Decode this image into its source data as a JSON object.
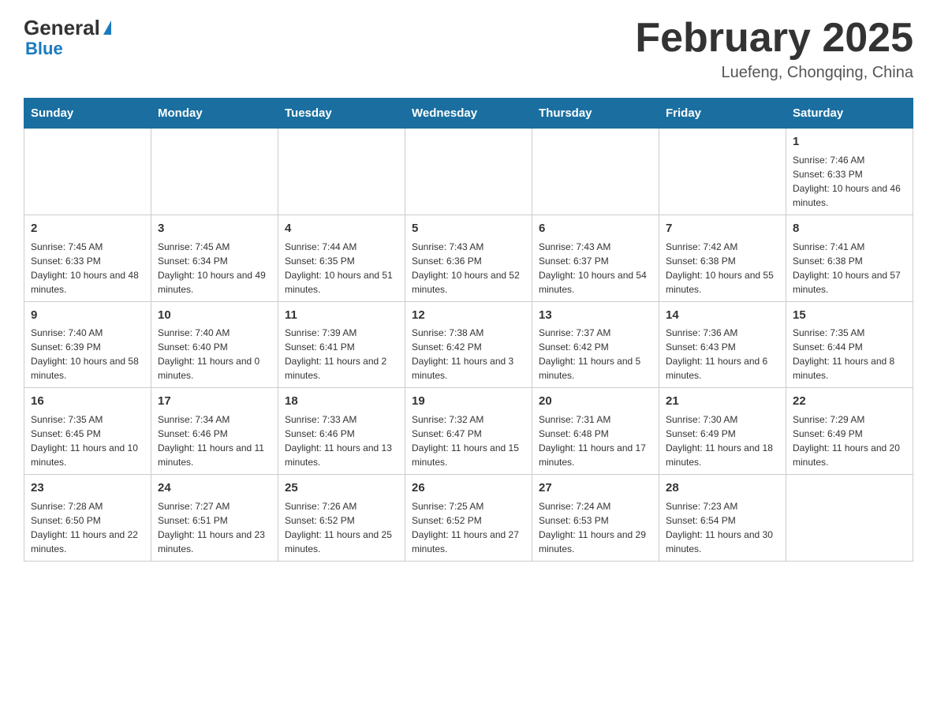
{
  "header": {
    "logo_general": "General",
    "logo_blue": "Blue",
    "title": "February 2025",
    "subtitle": "Luefeng, Chongqing, China"
  },
  "days_of_week": [
    "Sunday",
    "Monday",
    "Tuesday",
    "Wednesday",
    "Thursday",
    "Friday",
    "Saturday"
  ],
  "weeks": [
    {
      "days": [
        {
          "num": "",
          "info": ""
        },
        {
          "num": "",
          "info": ""
        },
        {
          "num": "",
          "info": ""
        },
        {
          "num": "",
          "info": ""
        },
        {
          "num": "",
          "info": ""
        },
        {
          "num": "",
          "info": ""
        },
        {
          "num": "1",
          "info": "Sunrise: 7:46 AM\nSunset: 6:33 PM\nDaylight: 10 hours and 46 minutes."
        }
      ]
    },
    {
      "days": [
        {
          "num": "2",
          "info": "Sunrise: 7:45 AM\nSunset: 6:33 PM\nDaylight: 10 hours and 48 minutes."
        },
        {
          "num": "3",
          "info": "Sunrise: 7:45 AM\nSunset: 6:34 PM\nDaylight: 10 hours and 49 minutes."
        },
        {
          "num": "4",
          "info": "Sunrise: 7:44 AM\nSunset: 6:35 PM\nDaylight: 10 hours and 51 minutes."
        },
        {
          "num": "5",
          "info": "Sunrise: 7:43 AM\nSunset: 6:36 PM\nDaylight: 10 hours and 52 minutes."
        },
        {
          "num": "6",
          "info": "Sunrise: 7:43 AM\nSunset: 6:37 PM\nDaylight: 10 hours and 54 minutes."
        },
        {
          "num": "7",
          "info": "Sunrise: 7:42 AM\nSunset: 6:38 PM\nDaylight: 10 hours and 55 minutes."
        },
        {
          "num": "8",
          "info": "Sunrise: 7:41 AM\nSunset: 6:38 PM\nDaylight: 10 hours and 57 minutes."
        }
      ]
    },
    {
      "days": [
        {
          "num": "9",
          "info": "Sunrise: 7:40 AM\nSunset: 6:39 PM\nDaylight: 10 hours and 58 minutes."
        },
        {
          "num": "10",
          "info": "Sunrise: 7:40 AM\nSunset: 6:40 PM\nDaylight: 11 hours and 0 minutes."
        },
        {
          "num": "11",
          "info": "Sunrise: 7:39 AM\nSunset: 6:41 PM\nDaylight: 11 hours and 2 minutes."
        },
        {
          "num": "12",
          "info": "Sunrise: 7:38 AM\nSunset: 6:42 PM\nDaylight: 11 hours and 3 minutes."
        },
        {
          "num": "13",
          "info": "Sunrise: 7:37 AM\nSunset: 6:42 PM\nDaylight: 11 hours and 5 minutes."
        },
        {
          "num": "14",
          "info": "Sunrise: 7:36 AM\nSunset: 6:43 PM\nDaylight: 11 hours and 6 minutes."
        },
        {
          "num": "15",
          "info": "Sunrise: 7:35 AM\nSunset: 6:44 PM\nDaylight: 11 hours and 8 minutes."
        }
      ]
    },
    {
      "days": [
        {
          "num": "16",
          "info": "Sunrise: 7:35 AM\nSunset: 6:45 PM\nDaylight: 11 hours and 10 minutes."
        },
        {
          "num": "17",
          "info": "Sunrise: 7:34 AM\nSunset: 6:46 PM\nDaylight: 11 hours and 11 minutes."
        },
        {
          "num": "18",
          "info": "Sunrise: 7:33 AM\nSunset: 6:46 PM\nDaylight: 11 hours and 13 minutes."
        },
        {
          "num": "19",
          "info": "Sunrise: 7:32 AM\nSunset: 6:47 PM\nDaylight: 11 hours and 15 minutes."
        },
        {
          "num": "20",
          "info": "Sunrise: 7:31 AM\nSunset: 6:48 PM\nDaylight: 11 hours and 17 minutes."
        },
        {
          "num": "21",
          "info": "Sunrise: 7:30 AM\nSunset: 6:49 PM\nDaylight: 11 hours and 18 minutes."
        },
        {
          "num": "22",
          "info": "Sunrise: 7:29 AM\nSunset: 6:49 PM\nDaylight: 11 hours and 20 minutes."
        }
      ]
    },
    {
      "days": [
        {
          "num": "23",
          "info": "Sunrise: 7:28 AM\nSunset: 6:50 PM\nDaylight: 11 hours and 22 minutes."
        },
        {
          "num": "24",
          "info": "Sunrise: 7:27 AM\nSunset: 6:51 PM\nDaylight: 11 hours and 23 minutes."
        },
        {
          "num": "25",
          "info": "Sunrise: 7:26 AM\nSunset: 6:52 PM\nDaylight: 11 hours and 25 minutes."
        },
        {
          "num": "26",
          "info": "Sunrise: 7:25 AM\nSunset: 6:52 PM\nDaylight: 11 hours and 27 minutes."
        },
        {
          "num": "27",
          "info": "Sunrise: 7:24 AM\nSunset: 6:53 PM\nDaylight: 11 hours and 29 minutes."
        },
        {
          "num": "28",
          "info": "Sunrise: 7:23 AM\nSunset: 6:54 PM\nDaylight: 11 hours and 30 minutes."
        },
        {
          "num": "",
          "info": ""
        }
      ]
    }
  ]
}
